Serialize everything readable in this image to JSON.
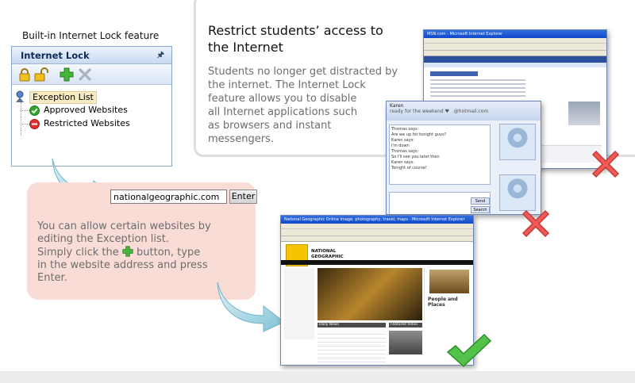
{
  "intro": {
    "title_line1": "Restrict students’ access to",
    "title_line2": "the Internet",
    "text_line1": "Students no longer get distracted by",
    "text_line2": "the internet. The Internet Lock",
    "text_line3": "feature allows you to disable",
    "text_line4": "all Internet applications such",
    "text_line5": "as browsers and instant",
    "text_line6": "messengers."
  },
  "feature_label": "Built-in Internet Lock feature",
  "panel": {
    "title": "Internet Lock",
    "pin_icon": "pin-icon",
    "toolbar": [
      "lock-icon",
      "unlock-icon",
      "add-icon",
      "delete-icon"
    ],
    "tree": {
      "root": "Exception List",
      "children": [
        "Approved Websites",
        "Restricted Websites"
      ]
    }
  },
  "url_input": {
    "value": "nationalgeographic.com"
  },
  "enter_button": "Enter",
  "pink": {
    "line1": "You can allow certain websites by",
    "line2": "editing the Exception list.",
    "line3a": "Simply click the",
    "line3b": "button, type",
    "line4": "in the website address and press",
    "line5": "Enter."
  },
  "msn": {
    "contact": "Karen",
    "status": "ready for the weekend ♥",
    "email": "@hotmail.com",
    "chat": [
      "Thomas says:",
      "  Are we up for tonight guys?",
      "Karen says:",
      "  I'm down",
      "Thomas says:",
      "  So I'll see you later then",
      "Karen says:",
      "  Tonight of course!"
    ],
    "send_button": "Send",
    "search_button": "Search"
  },
  "shots": {
    "yahoo_title": "MSN.com - Microsoft Internet Explorer",
    "natgeo_title": "National Geographic Online Image, photography, travel, maps - Microsoft Internet Explorer",
    "natgeo_banner": "NATIONAL GEOGRAPHIC",
    "natgeo_section": "People and Places",
    "natgeo_news": "Daily News",
    "natgeo_video": "Featured Video"
  },
  "colors": {
    "accent_green": "#3aa13a",
    "accent_red": "#e34a4a",
    "arrow_blue": "#8cc7d8",
    "pink_bg": "#f9dcd6"
  }
}
